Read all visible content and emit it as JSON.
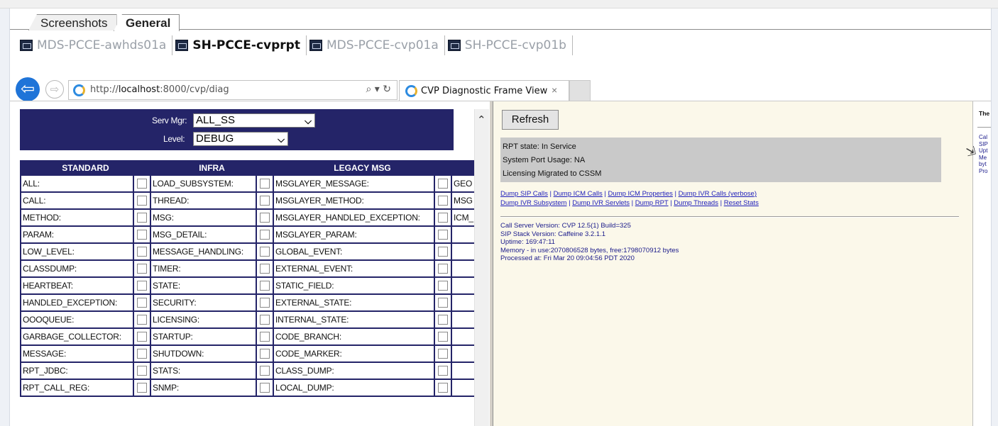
{
  "outer_tabs": [
    {
      "label": "Screenshots"
    },
    {
      "label": "General"
    }
  ],
  "sessions": [
    {
      "label": "MDS-PCCE-awhds01a"
    },
    {
      "label": "SH-PCCE-cvprpt"
    },
    {
      "label": "MDS-PCCE-cvp01a"
    },
    {
      "label": "SH-PCCE-cvp01b"
    }
  ],
  "browser": {
    "url_prefix": "http://",
    "url_host": "localhost",
    "url_rest": ":8000/cvp/diag",
    "search_icon": "search-icon",
    "refresh_icon": "reload-icon",
    "tab_title": "CVP Diagnostic Frame View",
    "tab_close": "×"
  },
  "controls": {
    "serv_mgr_label": "Serv Mgr:",
    "serv_mgr_value": "ALL_SS",
    "level_label": "Level:",
    "level_value": "DEBUG"
  },
  "grid": {
    "headers": [
      "STANDARD",
      "INFRA",
      "LEGACY MSG"
    ],
    "rows": [
      [
        "ALL:",
        "LOAD_SUBSYSTEM:",
        "MSGLAYER_MESSAGE:",
        "GEO"
      ],
      [
        "CALL:",
        "THREAD:",
        "MSGLAYER_METHOD:",
        "MSG"
      ],
      [
        "METHOD:",
        "MSG:",
        "MSGLAYER_HANDLED_EXCEPTION:",
        "ICM_"
      ],
      [
        "PARAM:",
        "MSG_DETAIL:",
        "MSGLAYER_PARAM:",
        ""
      ],
      [
        "LOW_LEVEL:",
        "MESSAGE_HANDLING:",
        "GLOBAL_EVENT:",
        ""
      ],
      [
        "CLASSDUMP:",
        "TIMER:",
        "EXTERNAL_EVENT:",
        ""
      ],
      [
        "HEARTBEAT:",
        "STATE:",
        "STATIC_FIELD:",
        ""
      ],
      [
        "HANDLED_EXCEPTION:",
        "SECURITY:",
        "EXTERNAL_STATE:",
        ""
      ],
      [
        "OOOQUEUE:",
        "LICENSING:",
        "INTERNAL_STATE:",
        ""
      ],
      [
        "GARBAGE_COLLECTOR:",
        "STARTUP:",
        "CODE_BRANCH:",
        ""
      ],
      [
        "MESSAGE:",
        "SHUTDOWN:",
        "CODE_MARKER:",
        ""
      ],
      [
        "RPT_JDBC:",
        "STATS:",
        "CLASS_DUMP:",
        ""
      ],
      [
        "RPT_CALL_REG:",
        "SNMP:",
        "LOCAL_DUMP:",
        ""
      ]
    ]
  },
  "right": {
    "refresh_label": "Refresh",
    "state_lines": [
      "RPT state: In Service",
      "System Port Usage: NA",
      "Licensing Migrated to CSSM"
    ],
    "links_row1": [
      "Dump SIP Calls",
      "Dump ICM Calls",
      "Dump ICM Properties",
      "Dump IVR Calls (verbose)"
    ],
    "links_row2": [
      "Dump IVR Subsystem",
      "Dump IVR Servlets",
      "Dump RPT",
      "Dump Threads",
      "Reset Stats"
    ],
    "info_lines": [
      "Call Server Version: CVP 12.5(1) Build=325",
      "SIP Stack Version: Caffeine 3.2.1.1",
      "Uptime: 169:47:11",
      "Memory - in use:2070806528 bytes, free:1798070912 bytes",
      "Processed at: Fri Mar 20 09:04:56 PDT 2020"
    ]
  },
  "right_sidebar": {
    "title": "The",
    "lines": [
      "Cal",
      "SIP",
      "Upt",
      "Me",
      "byt",
      "Pro"
    ]
  },
  "colors": {
    "frame_navy": "#242468",
    "frame_background": "#fbf8ea",
    "link_blue": "#1d1dba"
  }
}
